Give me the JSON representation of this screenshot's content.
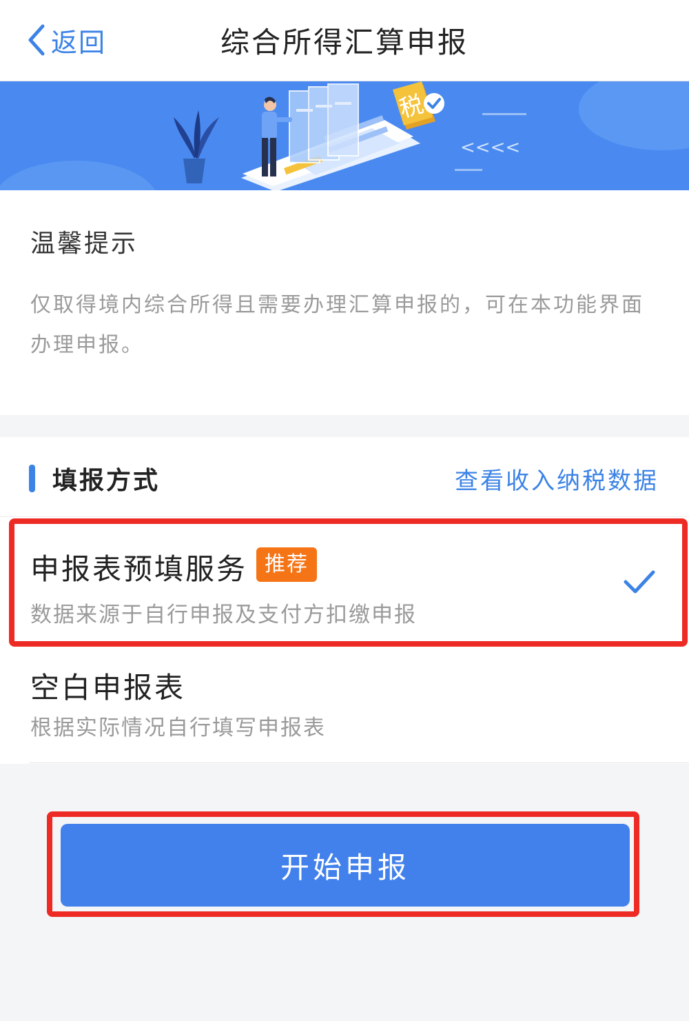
{
  "nav": {
    "back_label": "返回",
    "title": "综合所得汇算申报"
  },
  "banner": {
    "badge_text": "税",
    "arrows": "<<<<",
    "colors": {
      "background": "#4a8af0",
      "badge": "#f5c33b",
      "check": "#3c83e6"
    }
  },
  "tip": {
    "title": "温馨提示",
    "text": "仅取得境内综合所得且需要办理汇算申报的，可在本功能界面办理申报。"
  },
  "method": {
    "title": "填报方式",
    "link": "查看收入纳税数据",
    "options": [
      {
        "title": "申报表预填服务",
        "badge": "推荐",
        "subtitle": "数据来源于自行申报及支付方扣缴申报",
        "selected": true
      },
      {
        "title": "空白申报表",
        "subtitle": "根据实际情况自行填写申报表",
        "selected": false
      }
    ]
  },
  "start_button": "开始申报",
  "colors": {
    "accent": "#3c83e6",
    "button": "#4281ec",
    "badge": "#f47416",
    "highlight": "#ee2a24",
    "muted_text": "#9a9a9a"
  }
}
